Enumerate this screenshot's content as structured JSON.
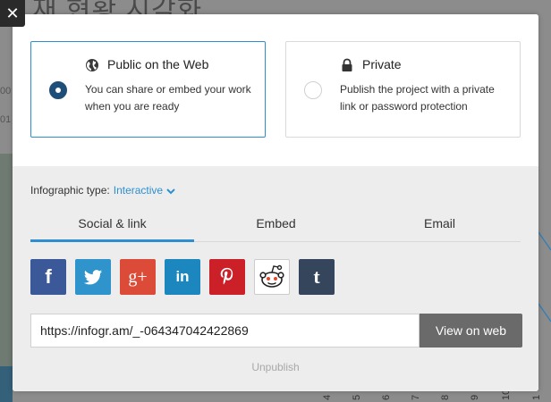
{
  "background": {
    "heading": "재 현황 시각화",
    "left_labels": [
      "00",
      "01"
    ],
    "axis_ticks": [
      "4",
      "5",
      "6",
      "7",
      "8",
      "9",
      "10",
      "1"
    ]
  },
  "close_button": {
    "label": "✕",
    "icon": "close-icon"
  },
  "visibility": {
    "public": {
      "title": "Public on the Web",
      "description": "You can share or embed your work when you are ready",
      "icon": "globe-icon",
      "selected": true
    },
    "private": {
      "title": "Private",
      "description": "Publish the project with a private link or password protection",
      "icon": "lock-icon",
      "selected": false
    }
  },
  "infographic_type": {
    "label": "Infographic type:",
    "value": "Interactive"
  },
  "tabs": [
    {
      "label": "Social & link",
      "active": true
    },
    {
      "label": "Embed",
      "active": false
    },
    {
      "label": "Email",
      "active": false
    }
  ],
  "social": [
    {
      "name": "facebook",
      "glyph": "f",
      "color": "#3b5998"
    },
    {
      "name": "twitter",
      "glyph": "",
      "color": "#2f94cc"
    },
    {
      "name": "google-plus",
      "glyph": "g+",
      "color": "#dc4a38"
    },
    {
      "name": "linkedin",
      "glyph": "in",
      "color": "#1c87bf"
    },
    {
      "name": "pinterest",
      "glyph": "p",
      "color": "#cb2027"
    },
    {
      "name": "reddit",
      "glyph": "",
      "color": "#ffffff"
    },
    {
      "name": "tumblr",
      "glyph": "t",
      "color": "#35465c"
    }
  ],
  "link": {
    "url": "https://infogr.am/_-064347042422869",
    "view_button": "View on web"
  },
  "unpublish_label": "Unpublish",
  "colors": {
    "accent": "#2d8fcf",
    "radio_checked": "#1f4e79"
  }
}
